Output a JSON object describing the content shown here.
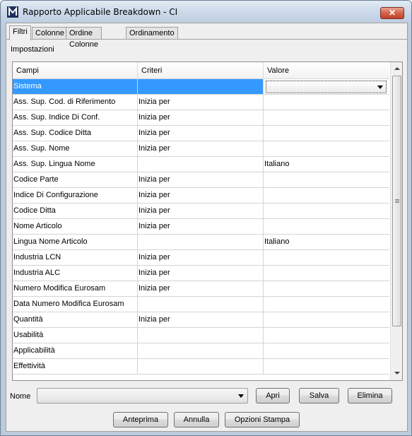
{
  "window": {
    "title": "Rapporto Applicabile Breakdown - CI",
    "close_label": "✕"
  },
  "tabs": [
    {
      "label": "Filtri",
      "active": true
    },
    {
      "label": "Colonne",
      "active": false
    },
    {
      "label": "Ordine Colonne",
      "active": false
    },
    {
      "label": "Ordinamento",
      "active": false
    }
  ],
  "section": {
    "label": "Impostazioni"
  },
  "table": {
    "headers": [
      "Campi",
      "Criteri",
      "Valore"
    ],
    "rows": [
      {
        "campo": "Sistema",
        "criterio": "",
        "valore": "",
        "selected": true
      },
      {
        "campo": "Ass. Sup. Cod. di Riferimento",
        "criterio": "Inizia per",
        "valore": ""
      },
      {
        "campo": "Ass. Sup. Indice Di Conf.",
        "criterio": "Inizia per",
        "valore": ""
      },
      {
        "campo": "Ass. Sup. Codice Ditta",
        "criterio": "Inizia per",
        "valore": ""
      },
      {
        "campo": "Ass. Sup. Nome",
        "criterio": "Inizia per",
        "valore": ""
      },
      {
        "campo": "Ass. Sup. Lingua Nome",
        "criterio": "",
        "valore": "Italiano"
      },
      {
        "campo": "Codice Parte",
        "criterio": "Inizia per",
        "valore": ""
      },
      {
        "campo": "Indice Di Configurazione",
        "criterio": "Inizia per",
        "valore": ""
      },
      {
        "campo": "Codice Ditta",
        "criterio": "Inizia per",
        "valore": ""
      },
      {
        "campo": "Nome Articolo",
        "criterio": "Inizia per",
        "valore": ""
      },
      {
        "campo": "Lingua Nome Articolo",
        "criterio": "",
        "valore": "Italiano"
      },
      {
        "campo": "Industria LCN",
        "criterio": "Inizia per",
        "valore": ""
      },
      {
        "campo": "Industria ALC",
        "criterio": "Inizia per",
        "valore": ""
      },
      {
        "campo": "Numero Modifica Eurosam",
        "criterio": "Inizia per",
        "valore": ""
      },
      {
        "campo": "Data Numero Modifica Eurosam",
        "criterio": "",
        "valore": ""
      },
      {
        "campo": "Quantità",
        "criterio": "Inizia per",
        "valore": ""
      },
      {
        "campo": "Usabilità",
        "criterio": "",
        "valore": ""
      },
      {
        "campo": "Applicabilità",
        "criterio": "",
        "valore": ""
      },
      {
        "campo": "Effettività",
        "criterio": "",
        "valore": ""
      }
    ]
  },
  "nome": {
    "label": "Nome",
    "value": ""
  },
  "buttons": {
    "apri": "Apri",
    "salva": "Salva",
    "elimina": "Elimina",
    "anteprima": "Anteprima",
    "annulla": "Annulla",
    "opzioni_stampa": "Opzioni Stampa"
  },
  "colors": {
    "selection": "#3399ff",
    "close_button": "#c9452b"
  }
}
